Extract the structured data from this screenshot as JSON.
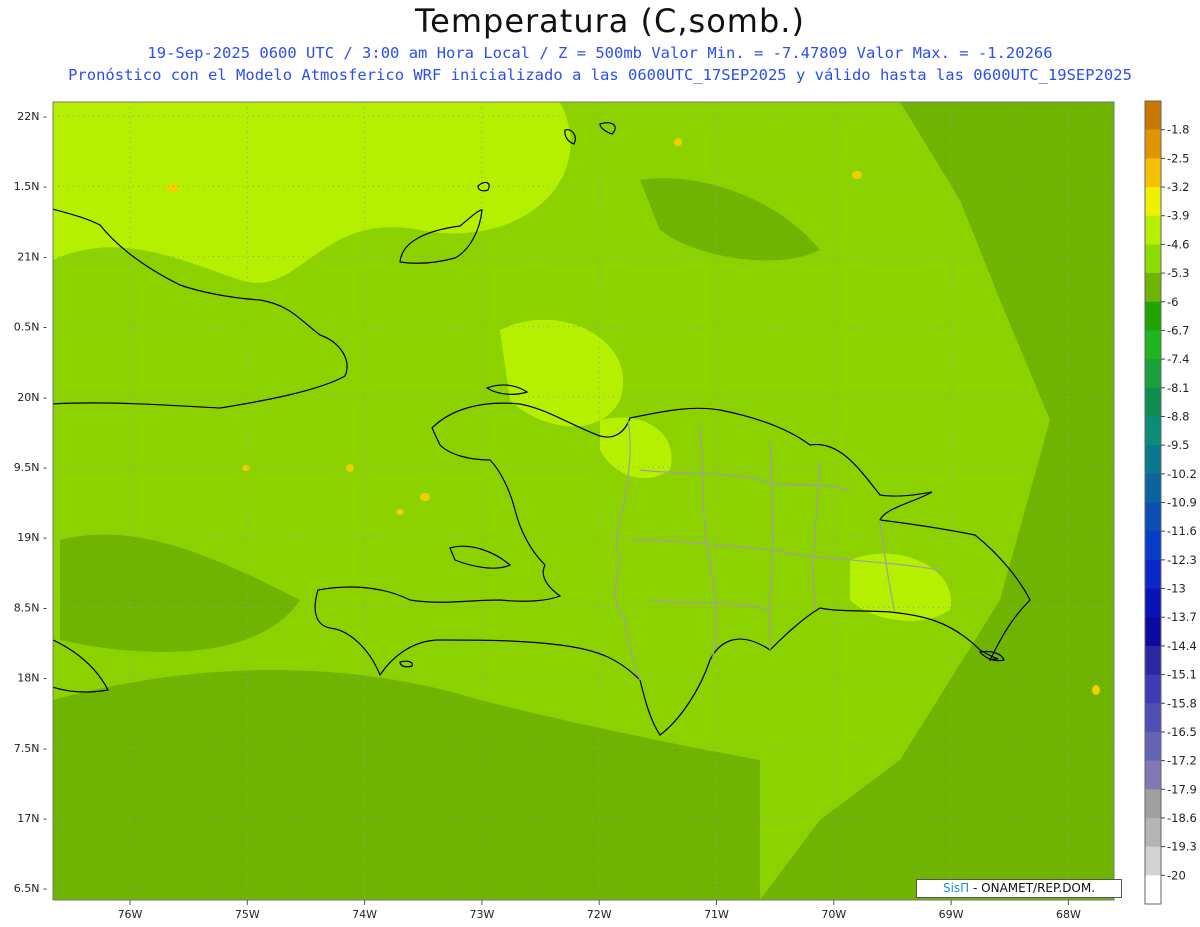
{
  "header": {
    "title": "Temperatura (C,somb.)",
    "line1": "19-Sep-2025  0600 UTC / 3:00 am Hora Local / Z = 500mb  Valor Min. = -7.47809  Valor Max. = -1.20266",
    "line2": "Pronóstico con el Modelo Atmosferico WRF inicializado a las 0600UTC_17SEP2025 y válido hasta las  0600UTC_19SEP2025"
  },
  "axes": {
    "lat_labels": [
      "22N",
      "1.5N",
      "21N",
      "0.5N",
      "20N",
      "9.5N",
      "19N",
      "8.5N",
      "18N",
      "7.5N",
      "17N",
      "6.5N"
    ],
    "lon_labels": [
      "76W",
      "75W",
      "74W",
      "73W",
      "72W",
      "71W",
      "70W",
      "69W",
      "68W"
    ]
  },
  "colorbar": {
    "labels": [
      "-1.8",
      "-2.5",
      "-3.2",
      "-3.9",
      "-4.6",
      "-5.3",
      "-6",
      "-6.7",
      "-7.4",
      "-8.1",
      "-8.8",
      "-9.5",
      "-10.2",
      "-10.9",
      "-11.6",
      "-12.3",
      "-13",
      "-13.7",
      "-14.4",
      "-15.1",
      "-15.8",
      "-16.5",
      "-17.2",
      "-17.9",
      "-18.6",
      "-19.3",
      "-20"
    ],
    "colors": [
      "#c87800",
      "#e09600",
      "#f5c000",
      "#f0f000",
      "#b4f000",
      "#8cdc00",
      "#6eb400",
      "#1ea500",
      "#20b520",
      "#1aa03c",
      "#0f8c50",
      "#0a8c78",
      "#0a788c",
      "#0a64a0",
      "#0a50b4",
      "#0a3cc8",
      "#0a28c8",
      "#0a14b4",
      "#0a0aa0",
      "#2828a0",
      "#3c3cb4",
      "#5050b4",
      "#6464b4",
      "#8278b4",
      "#a0a0a0",
      "#b4b4b4",
      "#d2d2d2",
      "#ffffff"
    ]
  },
  "credit": {
    "brand": "SisΠ",
    "text": " - ONAMET/REP.DOM."
  },
  "map": {
    "background_color": "#8cd200",
    "dark_color": "#6eb400",
    "light_color": "#b4f000",
    "hot_color": "#f0d000",
    "coast_color": "#000000",
    "border_color": "#a0a0a0"
  }
}
